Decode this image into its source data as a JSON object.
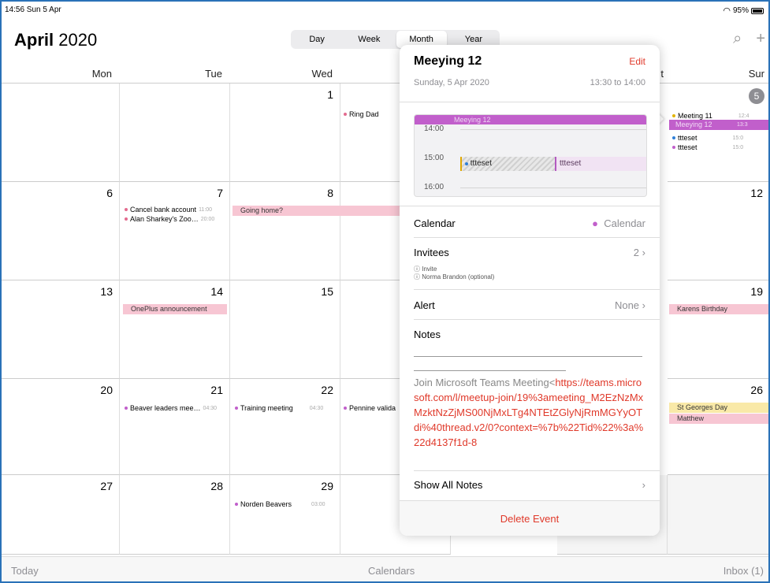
{
  "status_bar": {
    "time": "14:56  Sun 5 Apr",
    "battery": "95%"
  },
  "header": {
    "month": "April",
    "year": "2020",
    "views": [
      "Day",
      "Week",
      "Month",
      "Year"
    ],
    "active_view": "Month"
  },
  "weekdays": [
    "Mon",
    "Tue",
    "Wed",
    "",
    "",
    "t",
    "Sun"
  ],
  "days": {
    "d1": "1",
    "d6": "6",
    "d7": "7",
    "d8": "8",
    "d13": "13",
    "d14": "14",
    "d15": "15",
    "d20": "20",
    "d21": "21",
    "d22": "22",
    "d27": "27",
    "d28": "28",
    "d29": "29",
    "sun5": "5",
    "sun12": "12",
    "sun19": "19",
    "sun26": "26"
  },
  "events": {
    "ring_dad": "Ring Dad",
    "cancel_bank": "Cancel bank account",
    "cancel_bank_time": "11:00",
    "alan": "Alan Sharkey's Zoo…",
    "alan_time": "20:00",
    "going_home": "Going home?",
    "oneplus": "OnePlus announcement",
    "beaver": "Beaver leaders mee…",
    "beaver_time": "04:30",
    "training": "Training meeting",
    "training_time": "04:30",
    "pennine": "Pennine valida",
    "norden": "Norden Beavers",
    "norden_time": "03:00",
    "meeting11": "Meeting 11",
    "meeting11_time": "12:4",
    "meeying12": "Meeying 12",
    "meeying12_time": "13:3",
    "ttteset1": "ttteset",
    "ttteset1_time": "15:0",
    "ttteset2": "ttteset",
    "ttteset2_time": "15:0",
    "karens": "Karens Birthday",
    "st_georges": "St Georges Day",
    "matthew": "Matthew"
  },
  "popover": {
    "title": "Meeying 12",
    "edit": "Edit",
    "date": "Sunday, 5 Apr 2020",
    "time_range": "13:30 to 14:00",
    "mini_hours": [
      "14:00",
      "15:00",
      "16:00"
    ],
    "mini_event_main": "Meeying 12",
    "mini_event_b": "ttteset",
    "mini_event_c": "ttteset",
    "calendar_label": "Calendar",
    "calendar_value": "Calendar",
    "invitees_label": "Invitees",
    "invitees_count": "2",
    "invitee_1": "Invite",
    "invitee_2": "Norma Brandon (optional)",
    "alert_label": "Alert",
    "alert_value": "None",
    "notes_label": "Notes",
    "notes_text": "Join Microsoft Teams Meeting<",
    "notes_link": "https://teams.microsoft.com/l/meetup-join/19%3ameeting_M2EzNzMxMzktNzZjMS00NjMxLTg4NTEtZGlyNjRmMGYyOTdi%40thread.v2/0?context=%7b%22Tid%22%3a%22d4137f1d-8",
    "show_all_notes": "Show All Notes",
    "delete": "Delete Event"
  },
  "bottom_bar": {
    "today": "Today",
    "calendars": "Calendars",
    "inbox": "Inbox (1)"
  },
  "colors": {
    "accent": "#e0392a",
    "purple": "#c15fcb",
    "pink_bar": "#f7c6d3",
    "yellow_bar": "#f9e9a8"
  }
}
